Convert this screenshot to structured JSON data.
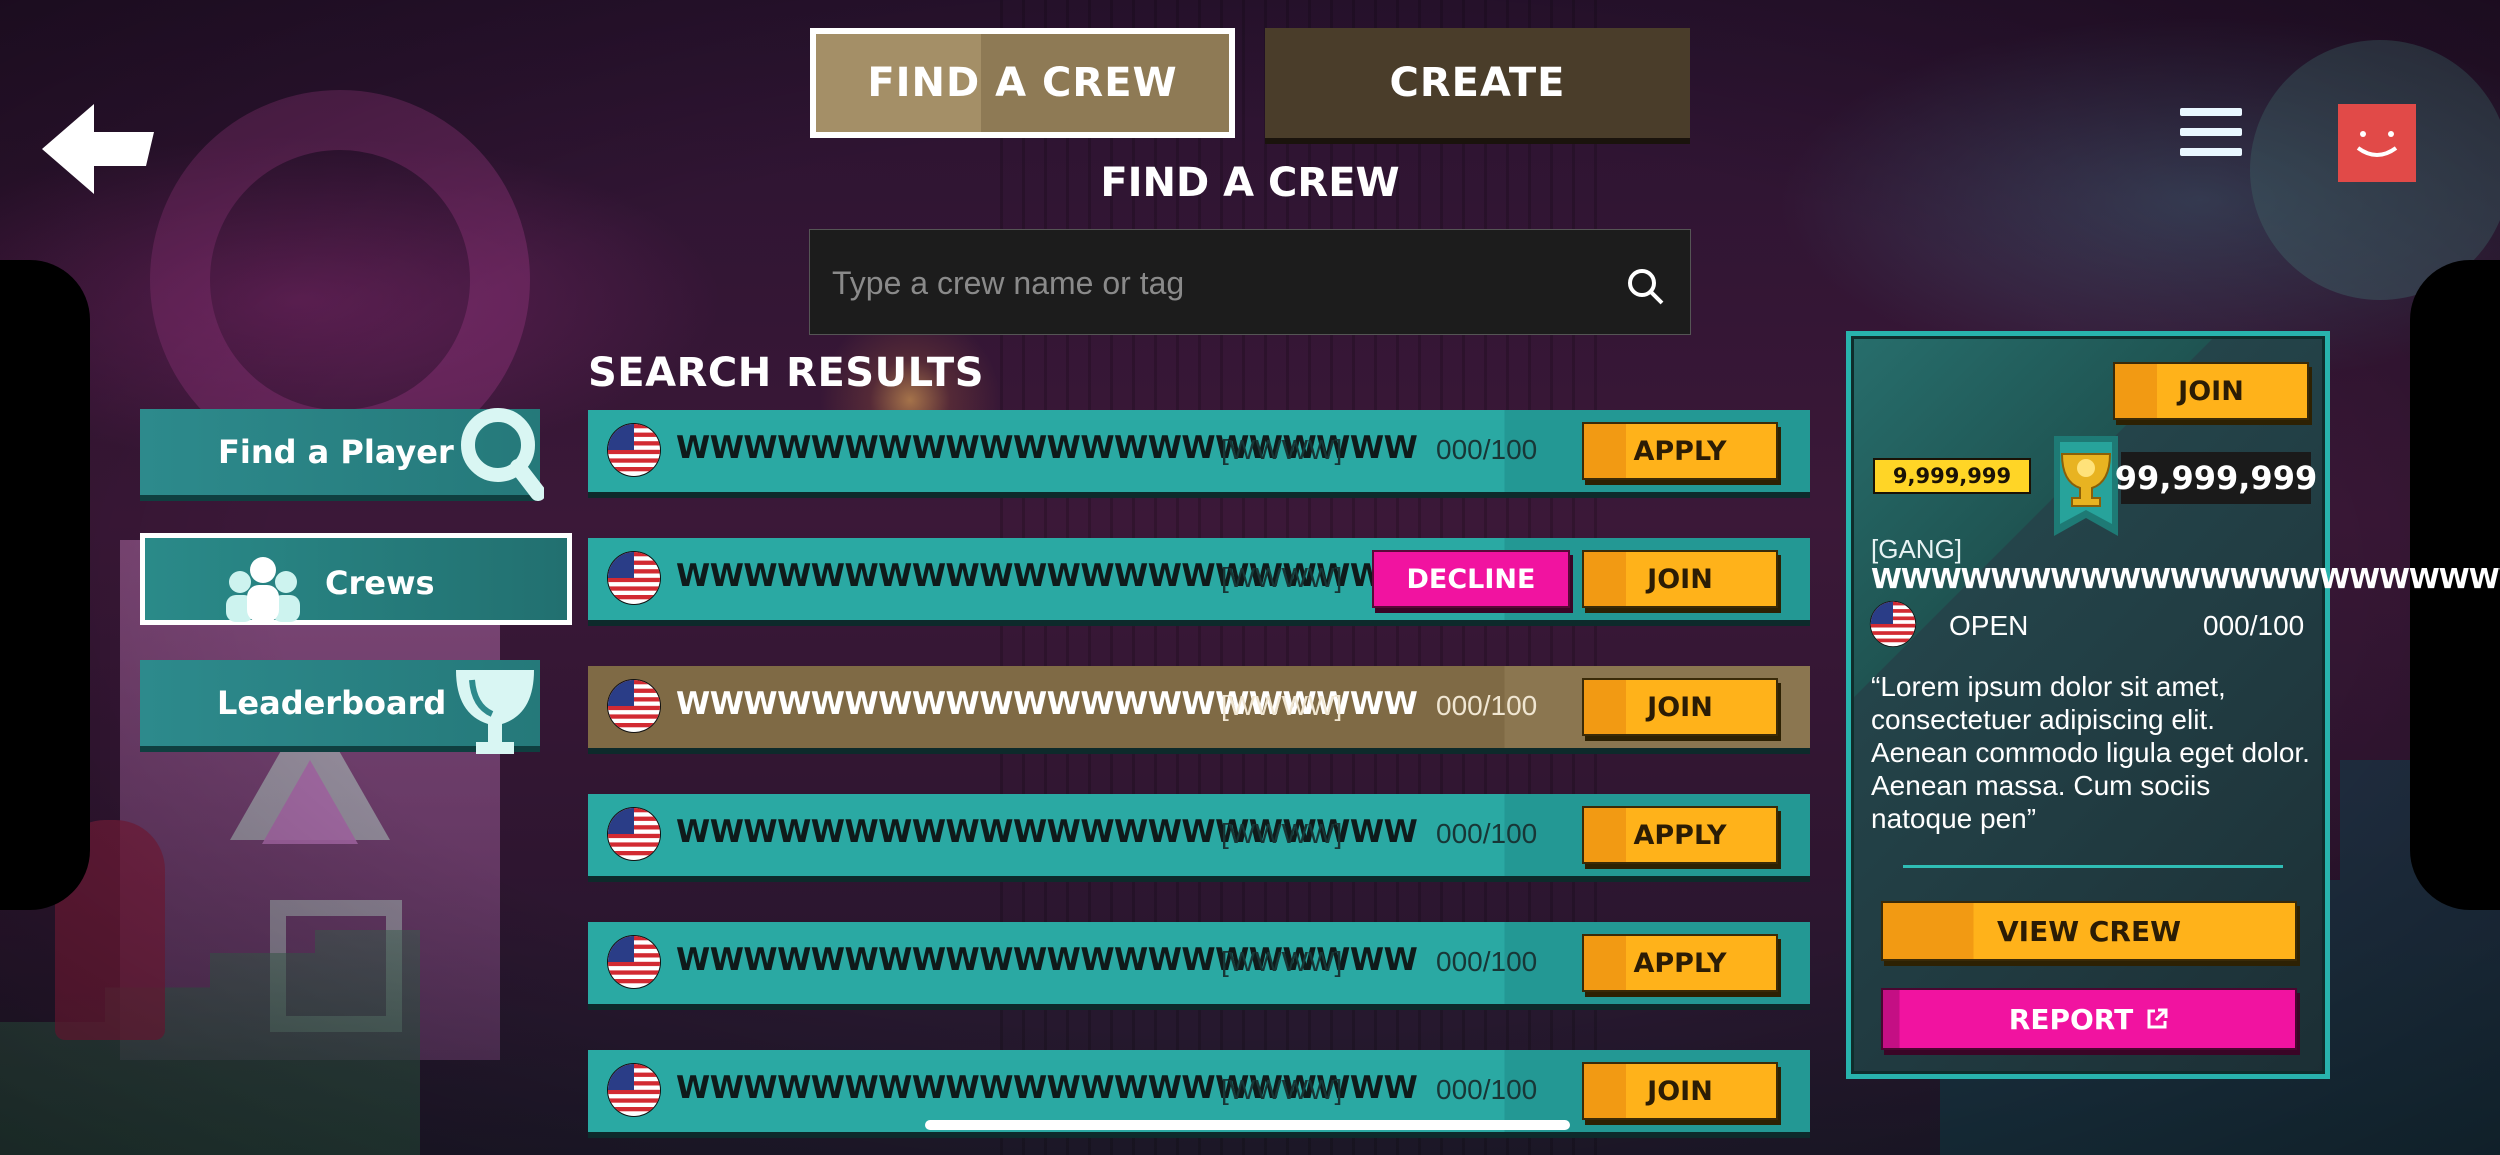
{
  "tabs": {
    "find_label": "FIND A CREW",
    "create_label": "CREATE"
  },
  "page_title": "FIND A CREW",
  "search": {
    "placeholder": "Type a crew name or tag",
    "value": ""
  },
  "results_title": "SEARCH RESULTS",
  "sidebar": {
    "items": [
      {
        "label": "Find a Player",
        "icon": "magnifier-icon"
      },
      {
        "label": "Crews",
        "icon": "crew-people-icon",
        "selected": true
      },
      {
        "label": "Leaderboard",
        "icon": "trophy-icon"
      }
    ]
  },
  "results": [
    {
      "name": "WWWWWWWWWWWWWWWWWWWWWW",
      "tag": "[WWWW]",
      "members": "000/100",
      "action": "APPLY",
      "decline": "",
      "style": "teal"
    },
    {
      "name": "WWWWWWWWWWWWWWWWWWWWWW",
      "tag": "[WWWW]",
      "members": "",
      "action": "JOIN",
      "decline": "DECLINE",
      "style": "teal"
    },
    {
      "name": "WWWWWWWWWWWWWWWWWWWWWW",
      "tag": "[WWWW]",
      "members": "000/100",
      "action": "JOIN",
      "decline": "",
      "style": "tan"
    },
    {
      "name": "WWWWWWWWWWWWWWWWWWWWWW",
      "tag": "[WWWW]",
      "members": "000/100",
      "action": "APPLY",
      "decline": "",
      "style": "teal"
    },
    {
      "name": "WWWWWWWWWWWWWWWWWWWWWW",
      "tag": "[WWWW]",
      "members": "000/100",
      "action": "APPLY",
      "decline": "",
      "style": "teal"
    },
    {
      "name": "WWWWWWWWWWWWWWWWWWWWWW",
      "tag": "[WWWW]",
      "members": "000/100",
      "action": "JOIN",
      "decline": "",
      "style": "teal"
    }
  ],
  "panel": {
    "join_label": "JOIN",
    "score": "9,999,999",
    "points": "99,999,999",
    "tag": "[GANG]",
    "name": "WWWWWWWWWWWWWWWWWWWWWW",
    "status": "OPEN",
    "members": "000/100",
    "description": "“Lorem ipsum dolor sit amet, consectetuer adipiscing elit. Aenean commodo ligula eget dolor. Aenean massa. Cum sociis natoque pen”",
    "view_label": "VIEW CREW",
    "report_label": "REPORT"
  },
  "colors": {
    "teal": "#2aa9a3",
    "tan": "#7f6a45",
    "yellow": "#ffb21a",
    "pink": "#f113a0",
    "avatar": "#e14a48"
  }
}
